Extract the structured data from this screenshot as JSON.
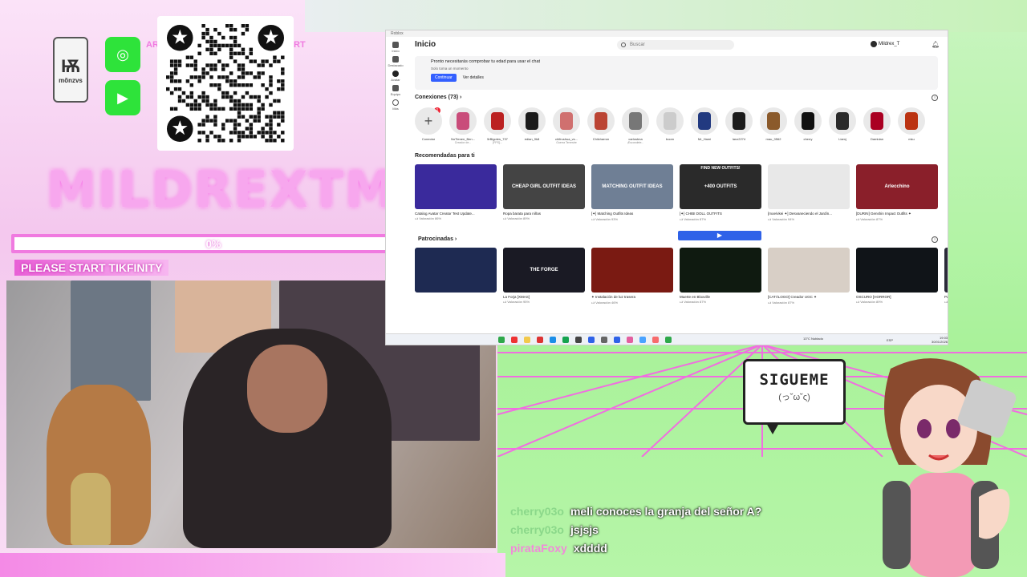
{
  "overlay": {
    "streamer_name": "MILDREXTM",
    "social_badge": "mõnzvs",
    "tik_progress": "0%",
    "tik_progress_value": 0,
    "tik_label": "PLEASE START TIKFINITY",
    "sigueme": "SIGUEME",
    "sigueme_face": "(っ˘ω˘ς)",
    "qr_text_left": "AR",
    "qr_text_right": "RT"
  },
  "browser": {
    "titlebar": "Roblox",
    "sidebar": [
      {
        "label": "Inicio"
      },
      {
        "label": "Destacado"
      },
      {
        "label": "Avatar"
      },
      {
        "label": "Equipo"
      },
      {
        "label": "Más"
      }
    ],
    "page_title": "Inicio",
    "search_placeholder": "Buscar",
    "user_name": "Mildrex_T",
    "notice": {
      "title": "Pronto necesitarás comprobar tu edad para usar el chat",
      "subtitle": "Solo toma un momento",
      "continue_label": "Continuar",
      "details_label": "Ver detalles"
    },
    "connections_title": "Conexiones (73)",
    "friends_badge": "1",
    "friends": [
      {
        "name": "Conectar",
        "status": ""
      },
      {
        "name": "NoTienen_Ben...",
        "status": "Creador de..."
      },
      {
        "name": "5rBigotes_737",
        "status": "[FPS]..."
      },
      {
        "name": "edian_9k8",
        "status": ""
      },
      {
        "name": "chifrushua_vs...",
        "status": "Guerra Terrestre"
      },
      {
        "name": "Chilcharron",
        "status": ""
      },
      {
        "name": "carlostma",
        "status": "¡Escondete..."
      },
      {
        "name": "boom",
        "status": ""
      },
      {
        "name": "Mr_Hami",
        "status": ""
      },
      {
        "name": "lanz2274",
        "status": ""
      },
      {
        "name": "mau_3562",
        "status": ""
      },
      {
        "name": "cherry",
        "status": ""
      },
      {
        "name": "Liamj",
        "status": ""
      },
      {
        "name": "Damidan",
        "status": ""
      },
      {
        "name": "mku",
        "status": ""
      }
    ],
    "recommended_title": "Recomendadas para ti",
    "recommended": [
      {
        "title": "Catalog Avatar Creator Test Update...",
        "rating": "Valoración 86%",
        "thumb": ""
      },
      {
        "title": "Ropa barata para niñas",
        "rating": "Valoración 89%",
        "thumb": "CHEAP GIRL OUTFIT IDEAS"
      },
      {
        "title": "[✦] Matching Outfits Ideas",
        "rating": "Valoración 93%",
        "thumb": "MATCHING OUTFIT IDEAS"
      },
      {
        "title": "[✦] CHIBI DOLL OUTFITS",
        "rating": "Valoración 87%",
        "thumb": "+400 OUTFITS"
      },
      {
        "title": "[moe/vkei ✦] Desvaneciendo el Jardín...",
        "rating": "Valoración 94%",
        "thumb": ""
      },
      {
        "title": "[DURIN] Genshin Impact Outfits ✦",
        "rating": "Valoración 87%",
        "thumb": "Arlecchino"
      }
    ],
    "find_outfits_label": "FIND NEW OUTFITS!",
    "sponsored_title": "Patrocinadas",
    "sponsored": [
      {
        "title": "",
        "rating": ""
      },
      {
        "title": "La Forja [XMAS]",
        "rating": "Valoración 95%",
        "thumb": "THE FORGE"
      },
      {
        "title": "✦ Instalación de luz trasera",
        "rating": "Valoración 46%",
        "thumb": ""
      },
      {
        "title": "Muerte en Bloxville",
        "rating": "Valoración 87%",
        "thumb": ""
      },
      {
        "title": "[CATÁLOGO] Creador UGC ✦",
        "rating": "Valoración 87%",
        "thumb": ""
      },
      {
        "title": "OSCURO [HORROR]",
        "rating": "Valoración 89%",
        "thumb": ""
      },
      {
        "title": "Palaci...",
        "rating": "Valoración",
        "thumb": ""
      }
    ],
    "taskbar": {
      "weather": "13°C Nublado",
      "lang": "ESP",
      "time": "19:03",
      "date": "30/01/2026"
    }
  },
  "chat": [
    {
      "user": "cherry03o",
      "message": "meli conoces la granja del señor A?",
      "color": "green"
    },
    {
      "user": "cherry03o",
      "message": "jsjsjs",
      "color": "green"
    },
    {
      "user": "pirataFoxy",
      "message": "xdddd",
      "color": "pink"
    }
  ],
  "colors": {
    "accent_pink": "#f07ae0",
    "accent_green": "#2ee33a",
    "roblox_blue": "#335fff"
  }
}
